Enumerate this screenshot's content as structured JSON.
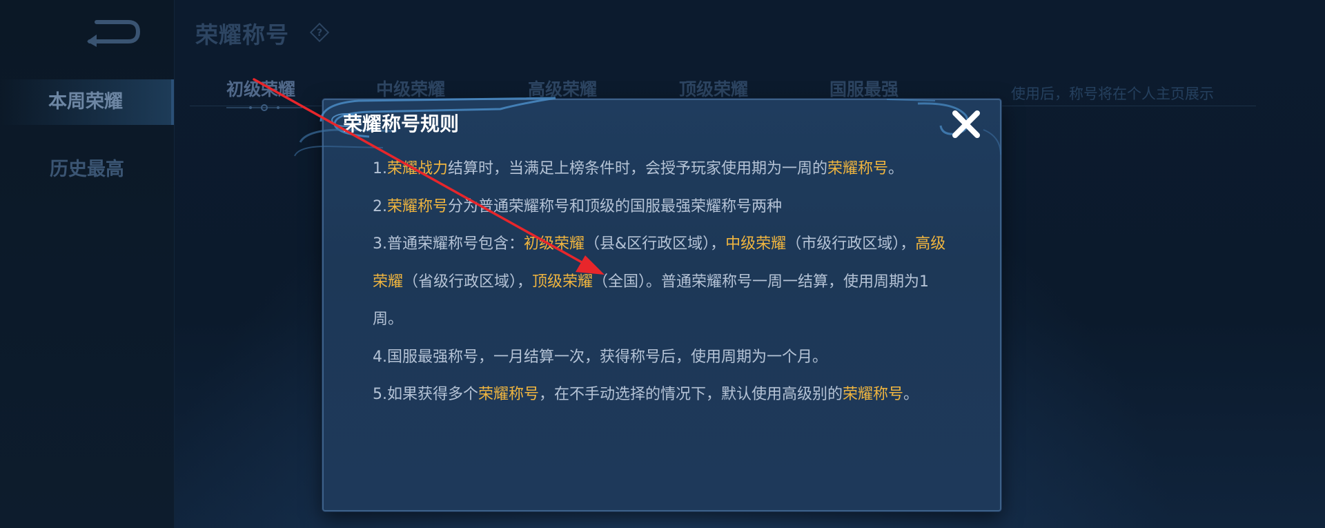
{
  "sidebar": {
    "items": [
      {
        "label": "本周荣耀",
        "active": true
      },
      {
        "label": "历史最高",
        "active": false
      }
    ]
  },
  "header": {
    "title": "荣耀称号",
    "tabs": [
      {
        "label": "初级荣耀",
        "active": true
      },
      {
        "label": "中级荣耀",
        "active": false
      },
      {
        "label": "高级荣耀",
        "active": false
      },
      {
        "label": "顶级荣耀",
        "active": false
      },
      {
        "label": "国服最强",
        "active": false
      }
    ],
    "note": "使用后，称号将在个人主页展示"
  },
  "dialog": {
    "title": "荣耀称号规则",
    "rules": [
      {
        "segments": [
          {
            "text": "1.",
            "highlight": false
          },
          {
            "text": "荣耀战力",
            "highlight": true
          },
          {
            "text": "结算时，当满足上榜条件时，会授予玩家使用期为一周的",
            "highlight": false
          },
          {
            "text": "荣耀称号",
            "highlight": true
          },
          {
            "text": "。",
            "highlight": false
          }
        ]
      },
      {
        "segments": [
          {
            "text": "2.",
            "highlight": false
          },
          {
            "text": "荣耀称号",
            "highlight": true
          },
          {
            "text": "分为普通荣耀称号和顶级的国服最强荣耀称号两种",
            "highlight": false
          }
        ]
      },
      {
        "segments": [
          {
            "text": "3.普通荣耀称号包含：",
            "highlight": false
          },
          {
            "text": "初级荣耀",
            "highlight": true
          },
          {
            "text": "（县&区行政区域），",
            "highlight": false
          },
          {
            "text": "中级荣耀",
            "highlight": true
          },
          {
            "text": "（市级行政区域），",
            "highlight": false
          },
          {
            "text": "高级荣耀",
            "highlight": true
          },
          {
            "text": "（省级行政区域），",
            "highlight": false
          },
          {
            "text": "顶级荣耀",
            "highlight": true
          },
          {
            "text": "（全国）。普通荣耀称号一周一结算，使用周期为1周。",
            "highlight": false
          }
        ]
      },
      {
        "segments": [
          {
            "text": "4.国服最强称号，一月结算一次，获得称号后，使用周期为一个月。",
            "highlight": false
          }
        ]
      },
      {
        "segments": [
          {
            "text": "5.如果获得多个",
            "highlight": false
          },
          {
            "text": "荣耀称号",
            "highlight": true
          },
          {
            "text": "，在不手动选择的情况下，默认使用高级别的",
            "highlight": false
          },
          {
            "text": "荣耀称号",
            "highlight": true
          },
          {
            "text": "。",
            "highlight": false
          }
        ]
      }
    ]
  },
  "icons": {
    "back": "back-arrow-icon",
    "help": "help-diamond-icon",
    "close": "close-x-icon"
  },
  "colors": {
    "highlight": "#f0b53f",
    "body_text": "#b5c3d6",
    "dialog_bg": "#1e3a5a",
    "dialog_border": "#3d6189",
    "annotation_arrow": "#e8262b"
  }
}
